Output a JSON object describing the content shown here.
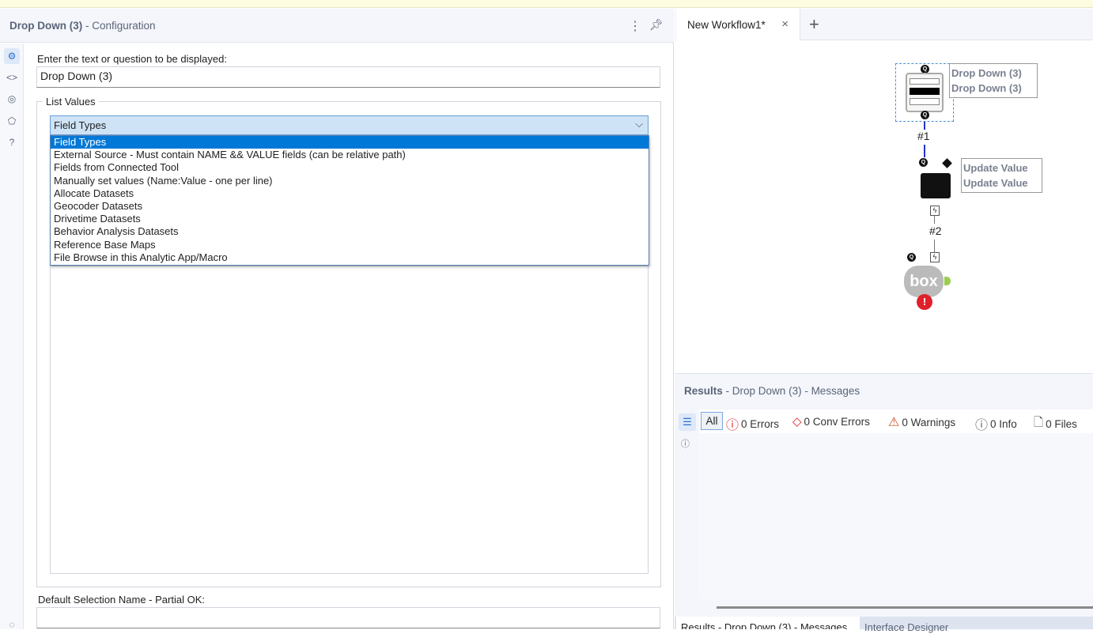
{
  "config": {
    "title": "Drop Down (3)",
    "subtitle": "- Configuration",
    "question_label": "Enter the text or question to be displayed:",
    "question_value": "Drop Down (3)",
    "group_label": "List Values",
    "dropdown_selected": "Field Types",
    "options": [
      "Field Types",
      "External Source - Must contain NAME && VALUE fields  (can be relative path)",
      "Fields from Connected Tool",
      "Manually set values (Name:Value - one per line)",
      "Allocate Datasets",
      "Geocoder Datasets",
      "Drivetime Datasets",
      "Behavior Analysis Datasets",
      "Reference Base Maps",
      "File Browse in this Analytic App/Macro"
    ],
    "default_label": "Default Selection Name - Partial OK:",
    "default_value": ""
  },
  "workflow": {
    "tab": "New Workflow1*",
    "tool1": {
      "ann1": "Drop Down (3)",
      "ann2": "Drop Down (3)"
    },
    "conn1": "#1",
    "tool2": {
      "ann1": "Update Value",
      "ann2": "Update Value"
    },
    "conn2": "#2",
    "tool3_logo": "box"
  },
  "results": {
    "title": "Results",
    "subtitle": "- Drop Down (3) - Messages",
    "all": "All",
    "errors": "0 Errors",
    "conv_errors": "0 Conv Errors",
    "warnings": "0 Warnings",
    "info": "0 Info",
    "files": "0 Files",
    "bottom_tabs": [
      "Results - Drop Down (3) - Messages",
      "Interface Designer"
    ]
  },
  "colors": {
    "accent": "#0078d7",
    "error": "#e0202a",
    "warning": "#d2542a"
  }
}
